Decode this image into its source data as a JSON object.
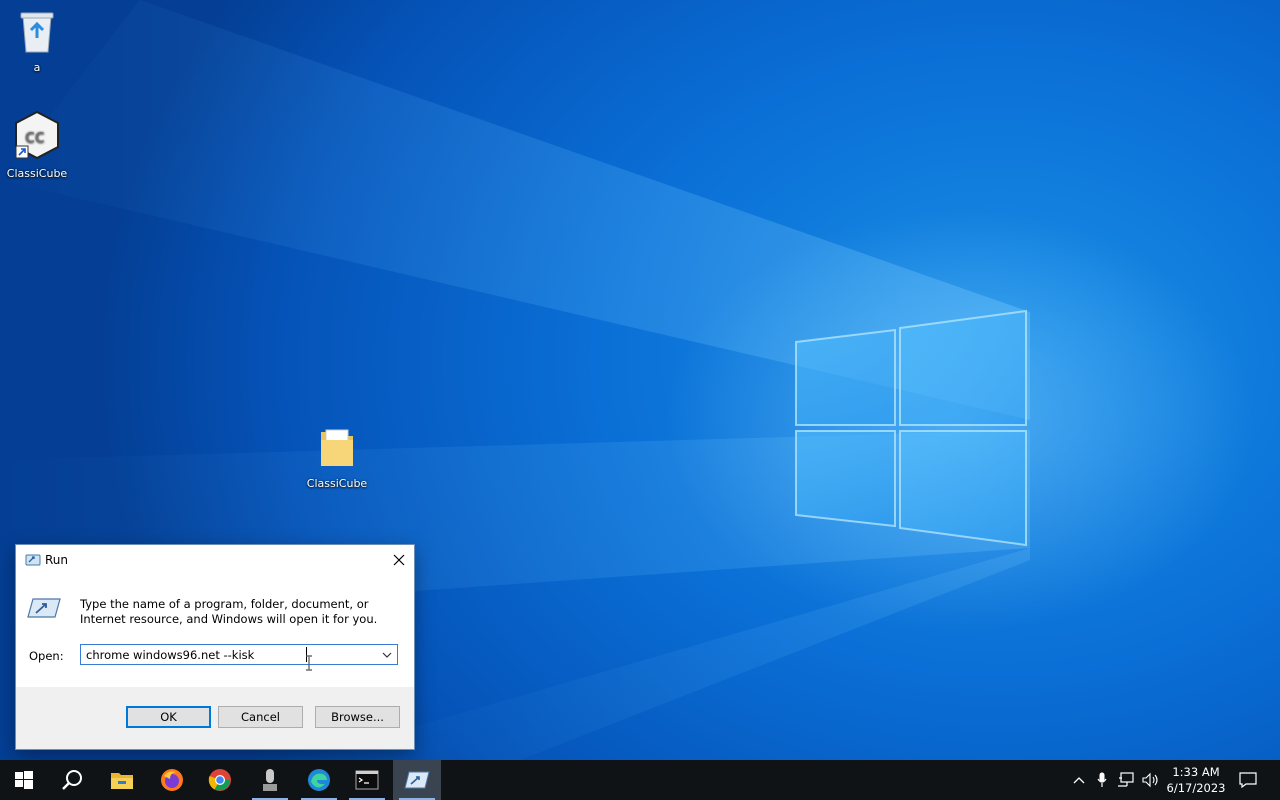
{
  "desktop": {
    "icons": [
      {
        "label": "a",
        "icon": "recycle-bin-icon"
      },
      {
        "label": "ClassiCube",
        "icon": "classicube-shortcut-icon"
      },
      {
        "label": "ClassiCube",
        "icon": "folder-icon"
      }
    ]
  },
  "run_dialog": {
    "title": "Run",
    "description": "Type the name of a program, folder, document, or Internet resource, and Windows will open it for you.",
    "open_label": "Open:",
    "open_value": "chrome windows96.net --kisk",
    "buttons": {
      "ok": "OK",
      "cancel": "Cancel",
      "browse": "Browse..."
    }
  },
  "taskbar": {
    "items": [
      "start-icon",
      "search-icon",
      "file-explorer-icon",
      "firefox-icon",
      "chrome-icon",
      "microphone-app-icon",
      "edge-icon",
      "terminal-icon",
      "run-icon"
    ],
    "active": "run-icon",
    "tray": [
      "chevron-up-icon",
      "microphone-icon",
      "network-icon",
      "volume-icon",
      "notification-icon"
    ],
    "time": "1:33 AM",
    "date": "6/17/2023"
  },
  "colors": {
    "desktop_blue": "#0a6fd6",
    "taskbar": "#101316",
    "accent": "#0078d7"
  }
}
